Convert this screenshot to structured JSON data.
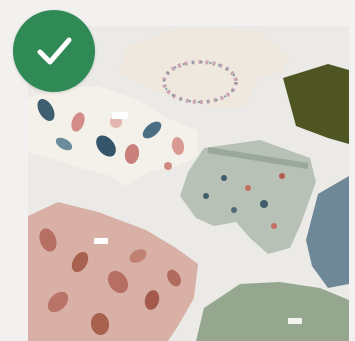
{
  "tile": {
    "selected": true,
    "status_label": "",
    "badge_color": "#2f8a56",
    "check_color": "#ffffff",
    "badge_icon": "checkmark-icon"
  },
  "photo": {
    "subject_icon": "baby-clothes-flat-lay",
    "items": [
      {
        "name": "cream-floral-wreath-bodysuit",
        "color": "#efe9e1"
      },
      {
        "name": "white-blue-floral-romper",
        "color": "#f3f0ec"
      },
      {
        "name": "sage-print-shorts",
        "color": "#b9c2b8"
      },
      {
        "name": "pink-floral-romper",
        "color": "#d9b2a7"
      },
      {
        "name": "olive-green-top",
        "color": "#4d5320"
      },
      {
        "name": "dusty-blue-top",
        "color": "#6f8797"
      },
      {
        "name": "sage-green-bodysuit",
        "color": "#97a892"
      }
    ]
  }
}
